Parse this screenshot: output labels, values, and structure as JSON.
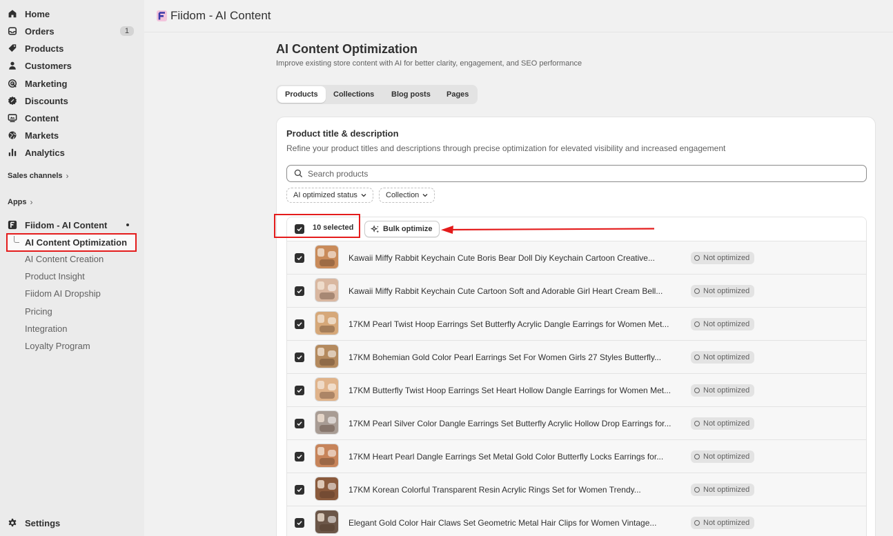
{
  "sidebar": {
    "nav": [
      {
        "label": "Home",
        "icon": "home-icon"
      },
      {
        "label": "Orders",
        "icon": "inbox-icon",
        "badge": "1"
      },
      {
        "label": "Products",
        "icon": "tag-icon"
      },
      {
        "label": "Customers",
        "icon": "person-icon"
      },
      {
        "label": "Marketing",
        "icon": "target-icon"
      },
      {
        "label": "Discounts",
        "icon": "discount-icon"
      },
      {
        "label": "Content",
        "icon": "content-icon"
      },
      {
        "label": "Markets",
        "icon": "globe-icon"
      },
      {
        "label": "Analytics",
        "icon": "bar-chart-icon"
      }
    ],
    "sales_channels": "Sales channels",
    "apps": "Apps",
    "app_name": "Fiidom - AI Content",
    "app_subitems": [
      {
        "label": "AI Content Optimization",
        "active": true
      },
      {
        "label": "AI Content Creation"
      },
      {
        "label": "Product Insight"
      },
      {
        "label": "Fiidom AI Dropship"
      },
      {
        "label": "Pricing"
      },
      {
        "label": "Integration"
      },
      {
        "label": "Loyalty Program"
      }
    ],
    "settings": "Settings"
  },
  "topbar": {
    "title": "Fiidom - AI Content"
  },
  "page": {
    "title": "AI Content Optimization",
    "subtitle": "Improve existing store content with AI for better clarity, engagement, and SEO performance",
    "tabs": [
      {
        "label": "Products",
        "active": true
      },
      {
        "label": "Collections"
      },
      {
        "label": "Blog posts"
      },
      {
        "label": "Pages"
      }
    ]
  },
  "card": {
    "title": "Product title & description",
    "description": "Refine your product titles and descriptions through precise optimization for elevated visibility and increased engagement",
    "search_placeholder": "Search products",
    "filters": [
      "AI optimized status",
      "Collection"
    ],
    "selected_label": "10 selected",
    "bulk_button": "Bulk optimize",
    "products": [
      {
        "title": "Kawaii Miffy Rabbit Keychain Cute Boris Bear Doll Diy Keychain Cartoon Creative...",
        "status": "Not optimized",
        "color": "#c98b5a"
      },
      {
        "title": "Kawaii Miffy Rabbit Keychain Cute Cartoon Soft and Adorable Girl Heart Cream Bell...",
        "status": "Not optimized",
        "color": "#d9b7a0"
      },
      {
        "title": "17KM Pearl Twist Hoop Earrings Set Butterfly Acrylic Dangle Earrings for Women Met...",
        "status": "Not optimized",
        "color": "#d6a879"
      },
      {
        "title": "17KM Bohemian Gold Color Pearl Earrings Set For Women Girls 27 Styles Butterfly...",
        "status": "Not optimized",
        "color": "#b48a5e"
      },
      {
        "title": "17KM Butterfly Twist Hoop Earrings Set Heart Hollow Dangle Earrings for Women Met...",
        "status": "Not optimized",
        "color": "#e0b38a"
      },
      {
        "title": "17KM Pearl Silver Color Dangle Earrings Set Butterfly Acrylic Hollow Drop Earrings for...",
        "status": "Not optimized",
        "color": "#a89c94"
      },
      {
        "title": "17KM Heart Pearl Dangle Earrings Set Metal Gold Color Butterfly Locks Earrings for...",
        "status": "Not optimized",
        "color": "#c7845a"
      },
      {
        "title": "17KM Korean Colorful Transparent Resin Acrylic Rings Set for Women Trendy...",
        "status": "Not optimized",
        "color": "#8a5a3c"
      },
      {
        "title": "Elegant Gold Color Hair Claws Set Geometric Metal Hair Clips for Women Vintage...",
        "status": "Not optimized",
        "color": "#6b5648"
      }
    ]
  },
  "colors": {
    "highlight": "#e41b1b",
    "checkbox": "#303030",
    "sidebar": "#ebebeb",
    "background": "#f1f1f1"
  }
}
